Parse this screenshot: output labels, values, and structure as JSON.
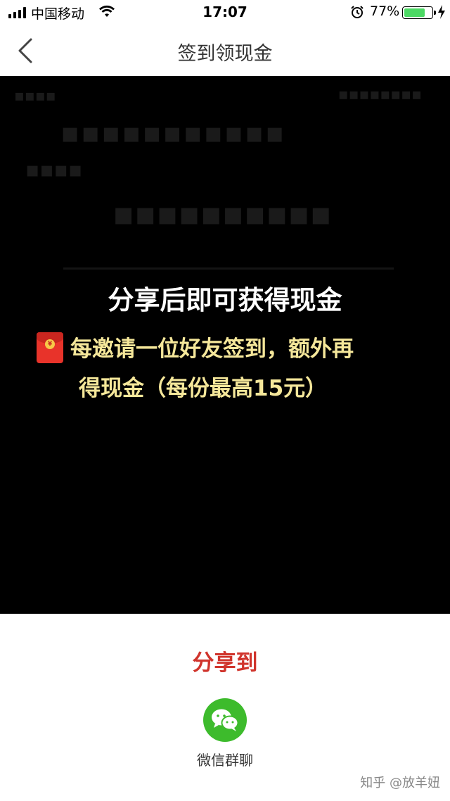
{
  "status_bar": {
    "carrier": "中国移动",
    "time": "17:07",
    "battery_percent": "77%",
    "battery_level": 0.77,
    "icons": [
      "signal-icon",
      "wifi-icon",
      "alarm-icon",
      "battery-icon",
      "charging-icon"
    ]
  },
  "nav": {
    "title": "签到领现金",
    "back_icon": "chevron-left-icon"
  },
  "overlay": {
    "headline": "分享后即可获得现金",
    "promo_line_1": "每邀请一位好友签到，额外再",
    "promo_line_2": "得现金（每份最高15元）",
    "promo_icon": "red-envelope-icon",
    "background_color": "#000000",
    "headline_color": "#ffffff",
    "promo_color": "#f5e79a"
  },
  "share_sheet": {
    "title": "分享到",
    "title_color": "#d0342c",
    "targets": [
      {
        "label": "微信群聊",
        "icon": "wechat-icon",
        "color": "#3dbb2c"
      }
    ]
  },
  "watermark": "知乎 @放羊妞"
}
